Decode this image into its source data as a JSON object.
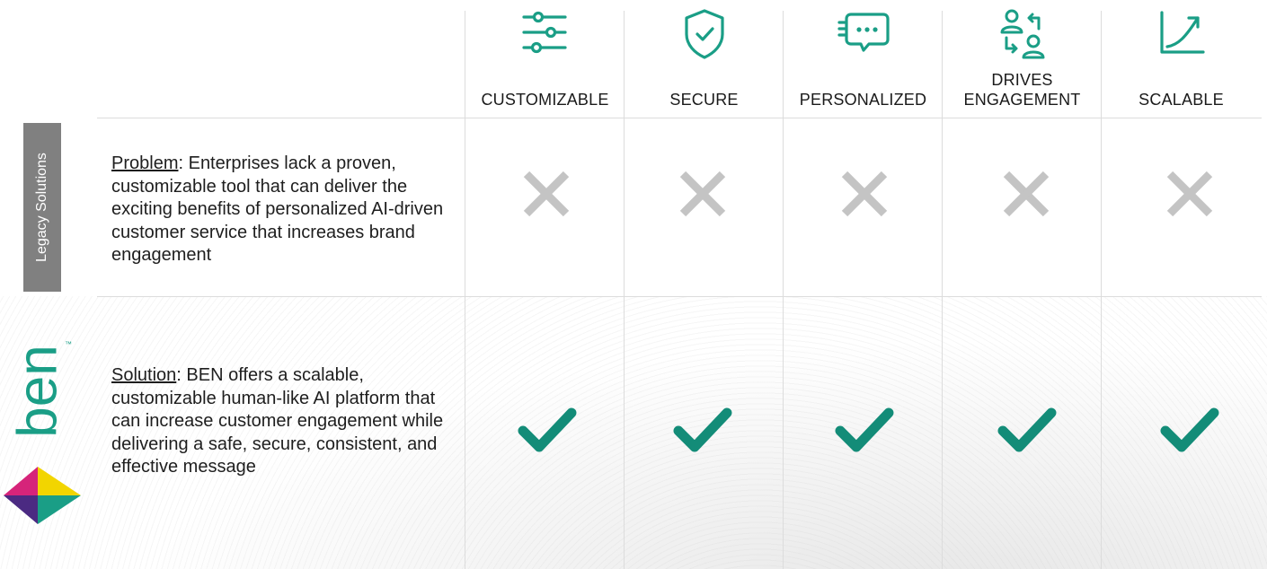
{
  "columns": [
    {
      "label": "CUSTOMIZABLE",
      "icon": "sliders-icon"
    },
    {
      "label": "SECURE",
      "icon": "shield-check-icon"
    },
    {
      "label": "PERSONALIZED",
      "icon": "chat-bubble-icon"
    },
    {
      "label": "DRIVES\nENGAGEMENT",
      "icon": "users-exchange-icon"
    },
    {
      "label": "SCALABLE",
      "icon": "growth-chart-icon"
    }
  ],
  "side": {
    "legacy_label": "Legacy Solutions",
    "brand_word": "ben",
    "trademark": "™"
  },
  "rows": {
    "problem": {
      "lead": "Problem",
      "text": ": Enterprises lack a proven, customizable tool that can deliver the exciting benefits of personalized AI-driven customer service that increases brand engagement",
      "mark": "x-icon"
    },
    "solution": {
      "lead": "Solution",
      "text": ": BEN offers a scalable, customizable human-like AI platform that can increase customer engagement while delivering a safe, secure, consistent, and effective message",
      "mark": "check-icon"
    }
  },
  "colors": {
    "accent": "#1a9e86",
    "cross": "#c4c4c4",
    "check": "#138c78",
    "grid": "#dcdcdc",
    "legacy_tab": "#808080"
  }
}
